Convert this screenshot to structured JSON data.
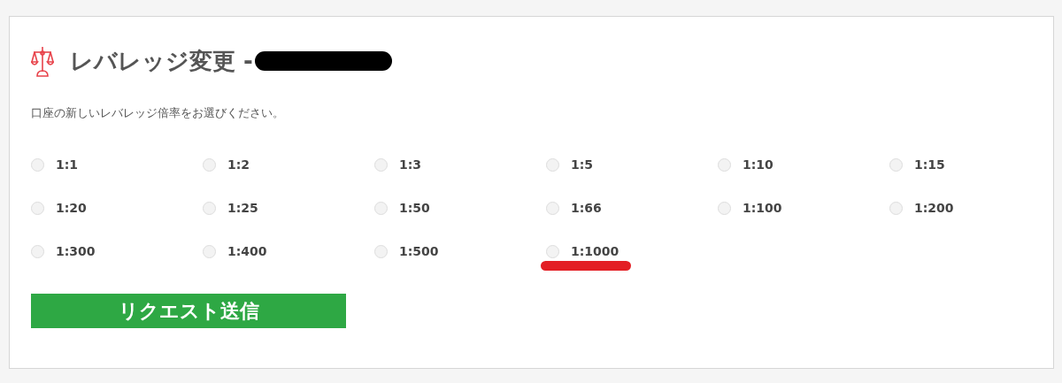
{
  "title": "レバレッジ変更 -",
  "instruction": "口座の新しいレバレッジ倍率をお選びください。",
  "options": [
    {
      "label": "1:1",
      "selected": false,
      "marked": false
    },
    {
      "label": "1:2",
      "selected": false,
      "marked": false
    },
    {
      "label": "1:3",
      "selected": false,
      "marked": false
    },
    {
      "label": "1:5",
      "selected": false,
      "marked": false
    },
    {
      "label": "1:10",
      "selected": false,
      "marked": false
    },
    {
      "label": "1:15",
      "selected": false,
      "marked": false
    },
    {
      "label": "1:20",
      "selected": false,
      "marked": false
    },
    {
      "label": "1:25",
      "selected": false,
      "marked": false
    },
    {
      "label": "1:50",
      "selected": false,
      "marked": false
    },
    {
      "label": "1:66",
      "selected": false,
      "marked": false
    },
    {
      "label": "1:100",
      "selected": false,
      "marked": false
    },
    {
      "label": "1:200",
      "selected": false,
      "marked": false
    },
    {
      "label": "1:300",
      "selected": false,
      "marked": false
    },
    {
      "label": "1:400",
      "selected": false,
      "marked": false
    },
    {
      "label": "1:500",
      "selected": false,
      "marked": false
    },
    {
      "label": "1:1000",
      "selected": false,
      "marked": true
    }
  ],
  "submit_button": "リクエスト送信"
}
